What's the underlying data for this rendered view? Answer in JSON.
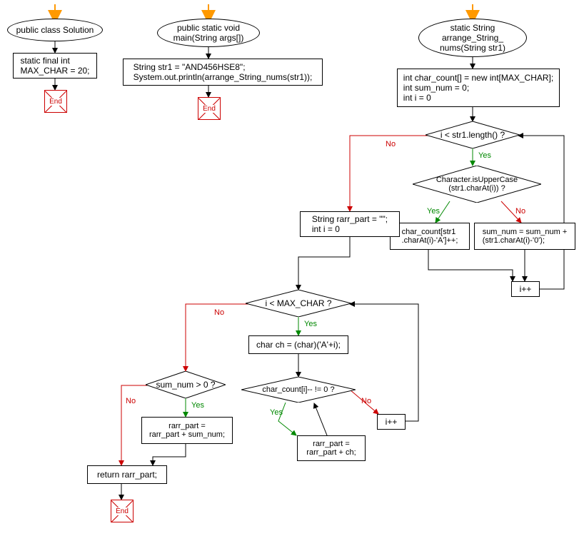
{
  "domain": "Diagram",
  "description": "Flowchart of a Java program with three sub-flowcharts: class declaration, main method, and arrange_String_nums method",
  "start_markers": [
    "orange-arrow",
    "orange-arrow",
    "orange-arrow"
  ],
  "oval_class": "public class Solution",
  "rect_maxchar": "static final int\nMAX_CHAR = 20;",
  "oval_main": "public static void\nmain(String args[])",
  "rect_mainbody": "String str1 = \"AND456HSE8\";\nSystem.out.println(arrange_String_nums(str1));",
  "oval_fn": "static String\narrange_String_\nnums(String str1)",
  "rect_init": "int char_count[] = new int[MAX_CHAR];\nint sum_num = 0;\nint i = 0",
  "cond_len": "i < str1.length() ?",
  "cond_upper": "Character.isUpperCase\n(str1.charAt(i)) ?",
  "rect_inc_count": "char_count[str1\n.charAt(i)-'A']++;",
  "rect_inc_sum": "sum_num = sum_num +\n(str1.charAt(i)-'0');",
  "rect_ipp_1": "i++",
  "rect_rarr_init": "String rarr_part = \"\";\nint i = 0",
  "cond_max": "i < MAX_CHAR ?",
  "rect_ch": "char ch = (char)('A'+i);",
  "cond_cc": "char_count[i]-- != 0 ?",
  "rect_rarr_ch": "rarr_part =\nrarr_part + ch;",
  "rect_ipp_2": "i++",
  "cond_sum": "sum_num > 0 ?",
  "rect_rarr_sum": "rarr_part =\nrarr_part + sum_num;",
  "rect_return": "return rarr_part;",
  "labels": {
    "yes": "Yes",
    "no": "No"
  },
  "end": "End",
  "chart_data": {
    "type": "flowchart",
    "subgraphs": [
      {
        "name": "class",
        "nodes": [
          {
            "id": "c_start",
            "type": "start"
          },
          {
            "id": "c_oval",
            "type": "terminator",
            "text": "public class Solution"
          },
          {
            "id": "c_rect",
            "type": "process",
            "text": "static final int MAX_CHAR = 20;"
          },
          {
            "id": "c_end",
            "type": "end",
            "text": "End"
          }
        ],
        "edges": [
          [
            "c_start",
            "c_oval"
          ],
          [
            "c_oval",
            "c_rect"
          ],
          [
            "c_rect",
            "c_end"
          ]
        ]
      },
      {
        "name": "main",
        "nodes": [
          {
            "id": "m_start",
            "type": "start"
          },
          {
            "id": "m_oval",
            "type": "terminator",
            "text": "public static void main(String args[])"
          },
          {
            "id": "m_rect",
            "type": "process",
            "text": "String str1 = \"AND456HSE8\"; System.out.println(arrange_String_nums(str1));"
          },
          {
            "id": "m_end",
            "type": "end",
            "text": "End"
          }
        ],
        "edges": [
          [
            "m_start",
            "m_oval"
          ],
          [
            "m_oval",
            "m_rect"
          ],
          [
            "m_rect",
            "m_end"
          ]
        ]
      },
      {
        "name": "arrange_String_nums",
        "nodes": [
          {
            "id": "f_start",
            "type": "start"
          },
          {
            "id": "f_oval",
            "type": "terminator",
            "text": "static String arrange_String_nums(String str1)"
          },
          {
            "id": "f_init",
            "type": "process",
            "text": "int char_count[] = new int[MAX_CHAR]; int sum_num = 0; int i = 0"
          },
          {
            "id": "f_len",
            "type": "decision",
            "text": "i < str1.length() ?"
          },
          {
            "id": "f_upper",
            "type": "decision",
            "text": "Character.isUpperCase(str1.charAt(i)) ?"
          },
          {
            "id": "f_inc_count",
            "type": "process",
            "text": "char_count[str1.charAt(i)-'A']++;"
          },
          {
            "id": "f_inc_sum",
            "type": "process",
            "text": "sum_num = sum_num + (str1.charAt(i)-'0');"
          },
          {
            "id": "f_ipp1",
            "type": "process",
            "text": "i++"
          },
          {
            "id": "f_rarr_init",
            "type": "process",
            "text": "String rarr_part = \"\"; int i = 0"
          },
          {
            "id": "f_max",
            "type": "decision",
            "text": "i < MAX_CHAR ?"
          },
          {
            "id": "f_ch",
            "type": "process",
            "text": "char ch = (char)('A'+i);"
          },
          {
            "id": "f_cc",
            "type": "decision",
            "text": "char_count[i]-- != 0 ?"
          },
          {
            "id": "f_rarr_ch",
            "type": "process",
            "text": "rarr_part = rarr_part + ch;"
          },
          {
            "id": "f_ipp2",
            "type": "process",
            "text": "i++"
          },
          {
            "id": "f_sum",
            "type": "decision",
            "text": "sum_num > 0 ?"
          },
          {
            "id": "f_rarr_sum",
            "type": "process",
            "text": "rarr_part = rarr_part + sum_num;"
          },
          {
            "id": "f_return",
            "type": "process",
            "text": "return rarr_part;"
          },
          {
            "id": "f_end",
            "type": "end",
            "text": "End"
          }
        ],
        "edges": [
          [
            "f_start",
            "f_oval"
          ],
          [
            "f_oval",
            "f_init"
          ],
          [
            "f_init",
            "f_len"
          ],
          [
            "f_len",
            "f_upper",
            "Yes"
          ],
          [
            "f_len",
            "f_rarr_init",
            "No"
          ],
          [
            "f_upper",
            "f_inc_count",
            "Yes"
          ],
          [
            "f_upper",
            "f_inc_sum",
            "No"
          ],
          [
            "f_inc_count",
            "f_ipp1"
          ],
          [
            "f_inc_sum",
            "f_ipp1"
          ],
          [
            "f_ipp1",
            "f_len"
          ],
          [
            "f_rarr_init",
            "f_max"
          ],
          [
            "f_max",
            "f_ch",
            "Yes"
          ],
          [
            "f_max",
            "f_sum",
            "No"
          ],
          [
            "f_ch",
            "f_cc"
          ],
          [
            "f_cc",
            "f_rarr_ch",
            "Yes"
          ],
          [
            "f_cc",
            "f_ipp2",
            "No"
          ],
          [
            "f_rarr_ch",
            "f_cc"
          ],
          [
            "f_ipp2",
            "f_max"
          ],
          [
            "f_sum",
            "f_rarr_sum",
            "Yes"
          ],
          [
            "f_sum",
            "f_return",
            "No"
          ],
          [
            "f_rarr_sum",
            "f_return"
          ],
          [
            "f_return",
            "f_end"
          ]
        ]
      }
    ]
  }
}
